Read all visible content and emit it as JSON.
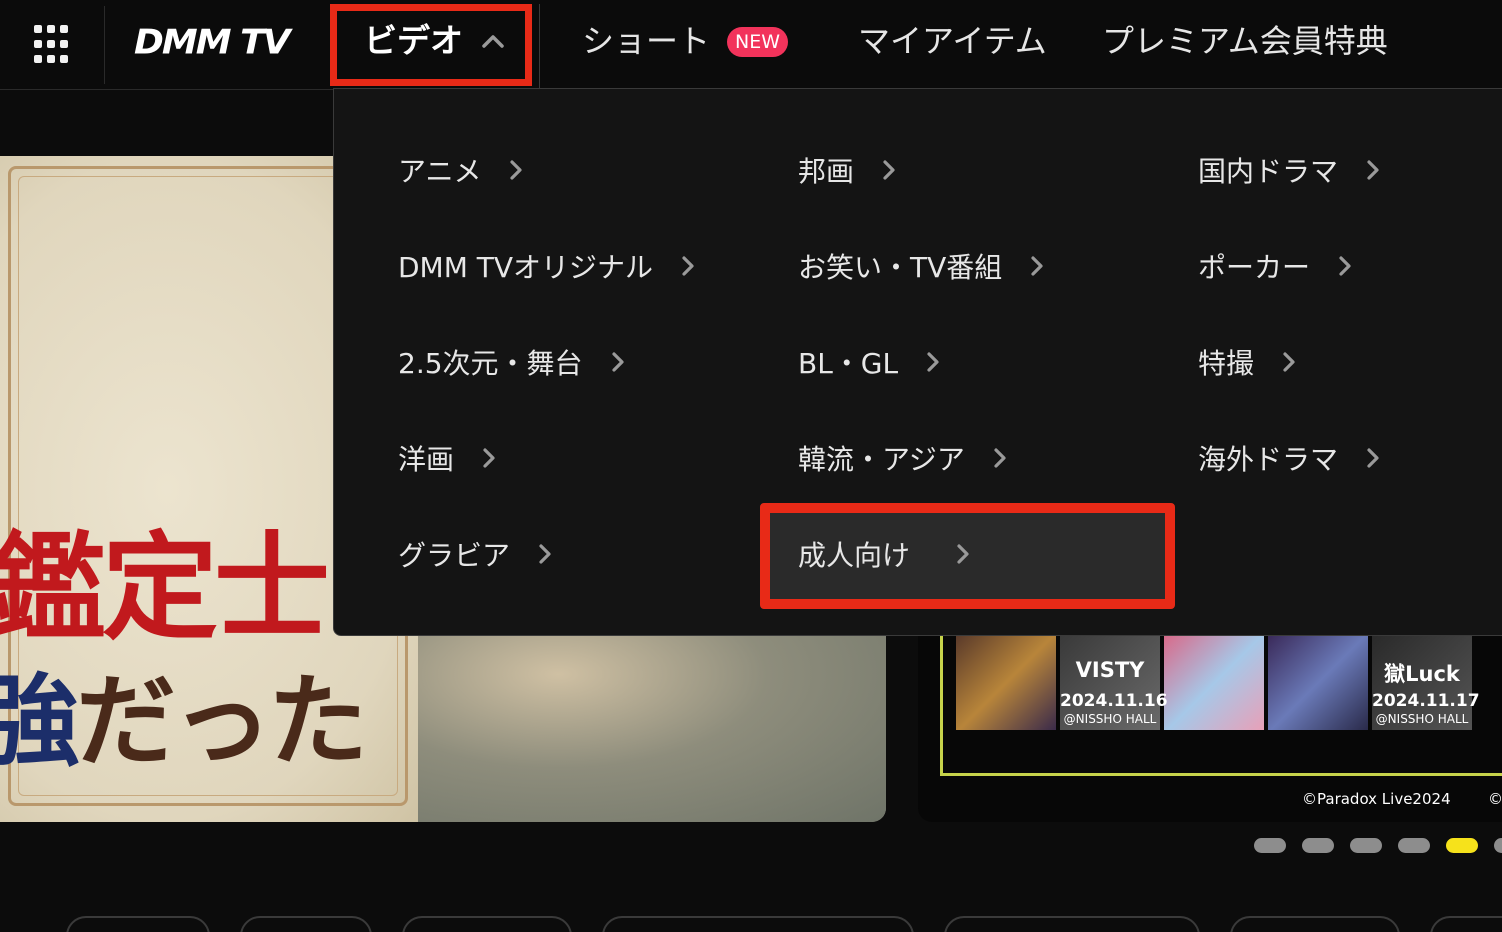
{
  "header": {
    "logo": "DMM TV",
    "nav": {
      "video": "ビデオ",
      "short": "ショート",
      "short_badge": "NEW",
      "my_items": "マイアイテム",
      "premium": "プレミアム会員特典"
    }
  },
  "menu": {
    "col1": [
      "アニメ",
      "DMM TVオリジナル",
      "2.5次元・舞台",
      "洋画",
      "グラビア"
    ],
    "col2": [
      "邦画",
      "お笑い・TV番組",
      "BL・GL",
      "韓流・アジア",
      "成人向け"
    ],
    "col3": [
      "国内ドラマ",
      "ポーカー",
      "特撮",
      "海外ドラマ"
    ],
    "highlighted_item": "成人向け"
  },
  "banner_left": {
    "title_line1": "鑑定士",
    "title_line2_a": "強",
    "title_line2_b": "だった"
  },
  "banner_right": {
    "poster1_title": "VISTY",
    "poster1_date": "2024.11.16",
    "poster1_venue": "@NISSHO HALL",
    "poster2_title": "獄Luck",
    "poster2_date": "2024.11.17",
    "poster2_venue": "@NISSHO HALL",
    "copyright": "©Paradox Live2024",
    "copyright2": "©"
  },
  "carousel": {
    "active_index": 4,
    "dot_count": 6
  },
  "colors": {
    "highlight_red": "#e82a17",
    "badge_pink": "#f2335b",
    "active_dot": "#f6e21b"
  }
}
